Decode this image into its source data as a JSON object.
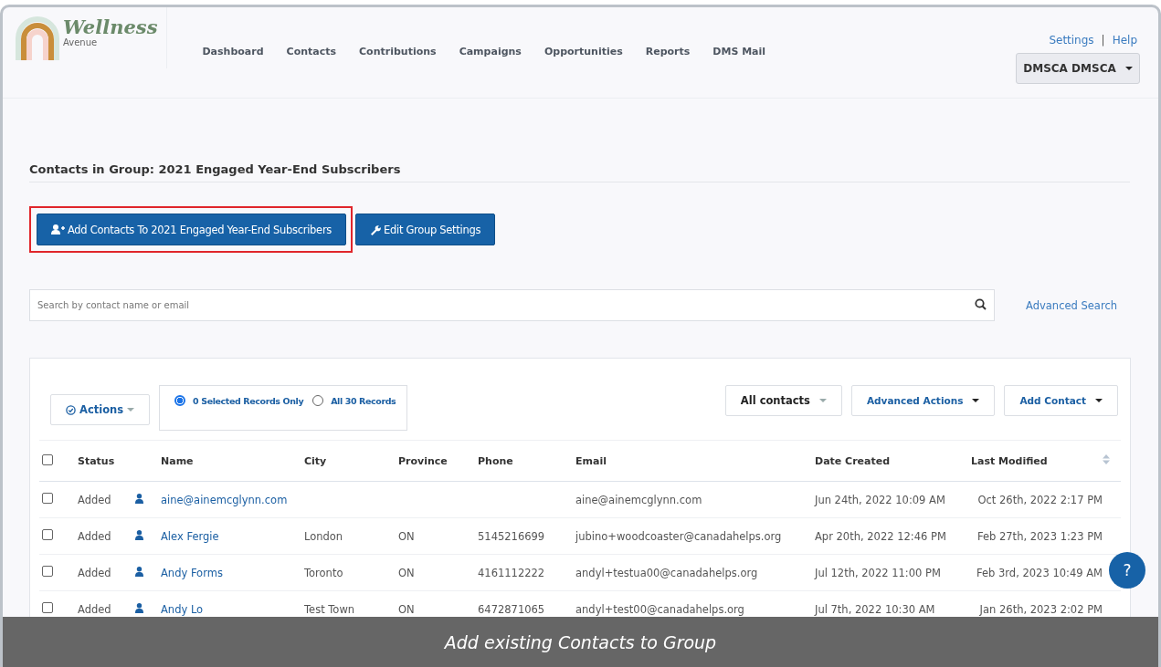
{
  "logo": {
    "title": "Wellness",
    "subtitle": "Avenue"
  },
  "nav": [
    "Dashboard",
    "Contacts",
    "Contributions",
    "Campaigns",
    "Opportunities",
    "Reports",
    "DMS Mail"
  ],
  "top_links": [
    "Settings",
    "|",
    "Help"
  ],
  "user_menu": "DMSCA DMSCA",
  "page_title": "Contacts in Group: 2021 Engaged Year-End Subscribers",
  "buttons": [
    {
      "label": "Add Contacts To 2021 Engaged Year-End Subscribers",
      "highlighted": true,
      "kind": "add"
    },
    {
      "label": "Edit Group Settings",
      "highlighted": false,
      "kind": "edit"
    }
  ],
  "search": {
    "placeholder": "Search by contact name or email"
  },
  "advanced_search": "Advanced Search",
  "actions": "Actions",
  "record_scope": [
    {
      "label": "0 Selected Records Only",
      "selected": true
    },
    {
      "label": "All 30 Records",
      "selected": false
    }
  ],
  "filter": "All contacts",
  "advanced_actions": "Advanced Actions",
  "add_contact": "Add Contact",
  "table": {
    "columns": [
      "Status",
      "Name",
      "City",
      "Province",
      "Phone",
      "Email",
      "Date Created",
      "Last Modified"
    ],
    "header_checked": false,
    "rows": [
      {
        "checked": false,
        "status": "Added",
        "name": "aine@ainemcglynn.com",
        "city": "",
        "province": "",
        "phone": "",
        "email": "aine@ainemcglynn.com",
        "created": "Jun 24th, 2022 10:09 AM",
        "modified": "Oct 26th, 2022 2:17 PM"
      },
      {
        "checked": false,
        "status": "Added",
        "name": "Alex Fergie",
        "city": "London",
        "province": "ON",
        "phone": "5145216699",
        "email": "jubino+woodcoaster@canadahelps.org",
        "created": "Apr 20th, 2022 12:46 PM",
        "modified": "Feb 27th, 2023 1:23 PM"
      },
      {
        "checked": false,
        "status": "Added",
        "name": "Andy Forms",
        "city": "Toronto",
        "province": "ON",
        "phone": "4161112222",
        "email": "andyl+testua00@canadahelps.org",
        "created": "Jul 12th, 2022 11:00 PM",
        "modified": "Feb 3rd, 2023 10:49 AM"
      },
      {
        "checked": false,
        "status": "Added",
        "name": "Andy Lo",
        "city": "Test Town",
        "province": "ON",
        "phone": "6472871065",
        "email": "andyl+test00@canadahelps.org",
        "created": "Jul 7th, 2022 10:30 AM",
        "modified": "Jan 26th, 2023 2:02 PM"
      }
    ]
  },
  "help_button": "?",
  "caption": "Add existing Contacts to Group"
}
